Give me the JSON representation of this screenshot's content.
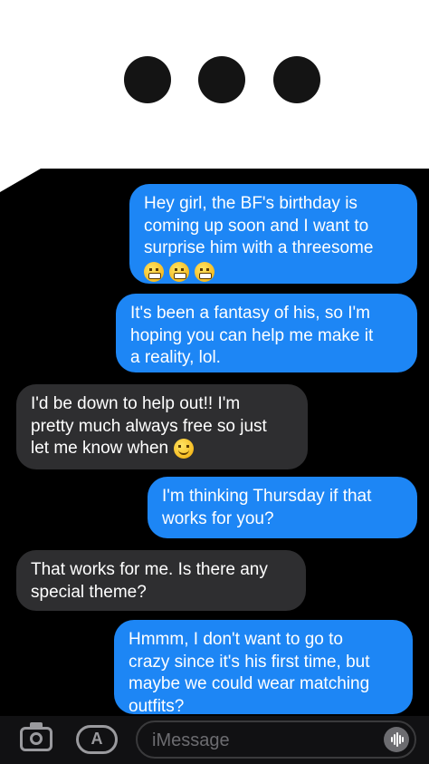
{
  "typing_indicator": {
    "dots": 3
  },
  "messages": [
    {
      "direction": "outgoing",
      "lines": [
        "Hey girl, the BF's birthday is",
        "coming up soon and I want to",
        "surprise him with a threesome"
      ],
      "emoji": [
        "grimacing-face",
        "grimacing-face",
        "grimacing-face"
      ]
    },
    {
      "direction": "outgoing",
      "lines": [
        "It's been a fantasy of his, so I'm",
        "hoping you can help me make it",
        "a reality, lol."
      ]
    },
    {
      "direction": "incoming",
      "lines": [
        "I'd be down to help out!! I'm",
        "pretty much always free so just",
        "let me know when"
      ],
      "emoji": [
        "smiling-face"
      ]
    },
    {
      "direction": "outgoing",
      "lines": [
        "I'm thinking Thursday if that",
        "works for you?"
      ]
    },
    {
      "direction": "incoming",
      "lines": [
        "That works for me. Is there any",
        "special theme?"
      ]
    },
    {
      "direction": "outgoing",
      "lines": [
        "Hmmm, I don't want to go to",
        "crazy since it's his first time, but",
        "maybe we could wear matching",
        "outfits?"
      ]
    }
  ],
  "input_bar": {
    "placeholder": "iMessage",
    "camera_icon": "camera-icon",
    "apps_icon": "app-store-icon",
    "audio_icon": "audio-waveform-icon"
  },
  "colors": {
    "outgoing_bubble": "#1d86f5",
    "incoming_bubble": "#2e2e30",
    "chat_background": "#000000",
    "page_background": "#ffffff"
  }
}
